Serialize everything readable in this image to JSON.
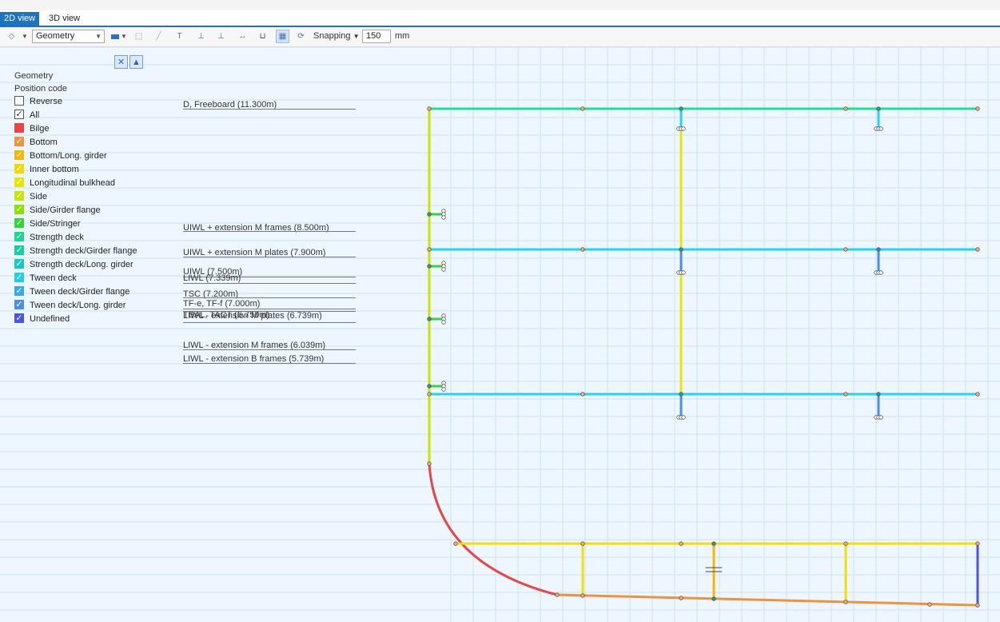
{
  "tabs": [
    {
      "label": "2D view",
      "active": true
    },
    {
      "label": "3D view",
      "active": false
    }
  ],
  "toolbar": {
    "layer_combo_value": "Geometry",
    "snapping_label": "Snapping",
    "snapping_value": "150",
    "unit": "mm",
    "icons": [
      "layer-icon",
      "color-fill-icon",
      "select-icon",
      "rule-icon",
      "t-profile-icon",
      "l-profile-icon",
      "double-l-icon",
      "flatbar-icon",
      "bracket-icon",
      "grid-icon",
      "refresh-icon"
    ]
  },
  "legend": {
    "title": "Geometry",
    "subtitle": "Position code",
    "reverse": {
      "label": "Reverse",
      "checked": false
    },
    "all": {
      "label": "All",
      "checked": true
    },
    "items": [
      {
        "label": "Bilge",
        "color": "#e84646",
        "checked": false
      },
      {
        "label": "Bottom",
        "color": "#f0913c",
        "checked": true
      },
      {
        "label": "Bottom/Long. girder",
        "color": "#f5b800",
        "checked": true
      },
      {
        "label": "Inner bottom",
        "color": "#f5d800",
        "checked": true
      },
      {
        "label": "Longitudinal bulkhead",
        "color": "#e2e800",
        "checked": true
      },
      {
        "label": "Side",
        "color": "#c6e800",
        "checked": true
      },
      {
        "label": "Side/Girder flange",
        "color": "#8ee000",
        "checked": true
      },
      {
        "label": "Side/Stringer",
        "color": "#33d633",
        "checked": true
      },
      {
        "label": "Strength deck",
        "color": "#1fd68a",
        "checked": true
      },
      {
        "label": "Strength deck/Girder flange",
        "color": "#15cfa4",
        "checked": true
      },
      {
        "label": "Strength deck/Long. girder",
        "color": "#18c8c4",
        "checked": true
      },
      {
        "label": "Tween deck",
        "color": "#22cce6",
        "checked": true
      },
      {
        "label": "Tween deck/Girder flange",
        "color": "#3aa8e8",
        "checked": true
      },
      {
        "label": "Tween deck/Long. girder",
        "color": "#4a90e2",
        "checked": true
      },
      {
        "label": "Undefined",
        "color": "#4a55e8",
        "checked": true
      }
    ]
  },
  "levels": [
    {
      "label": "D, Freeboard (11.300m)"
    },
    {
      "label": "UIWL + extension M frames (8.500m)"
    },
    {
      "label": "UIWL + extension M plates (7.900m)"
    },
    {
      "label": "UIWL (7.500m)"
    },
    {
      "label": "LIWL (7.339m)"
    },
    {
      "label": "TSC (7.200m)"
    },
    {
      "label": "TF-e, TF-f (7.000m)"
    },
    {
      "label": "TBAL, TACT (6.750m)"
    },
    {
      "label": "LIWL - extension M plates (6.739m)"
    },
    {
      "label": "LIWL - extension M frames (6.039m)"
    },
    {
      "label": "LIWL - extension B frames (5.739m)"
    }
  ],
  "drawing": {
    "colors": {
      "deck": "#1fe090",
      "tween": "#22d4ee",
      "side": "#c8e600",
      "bilge": "#e84646",
      "inner_bottom": "#f2e000",
      "bottom": "#f0913c",
      "girder": "#f5b800",
      "undefined": "#4a55e8",
      "long_girder": "#4a90e2",
      "bulkhead": "#e2e800",
      "stringer": "#33d633"
    }
  }
}
